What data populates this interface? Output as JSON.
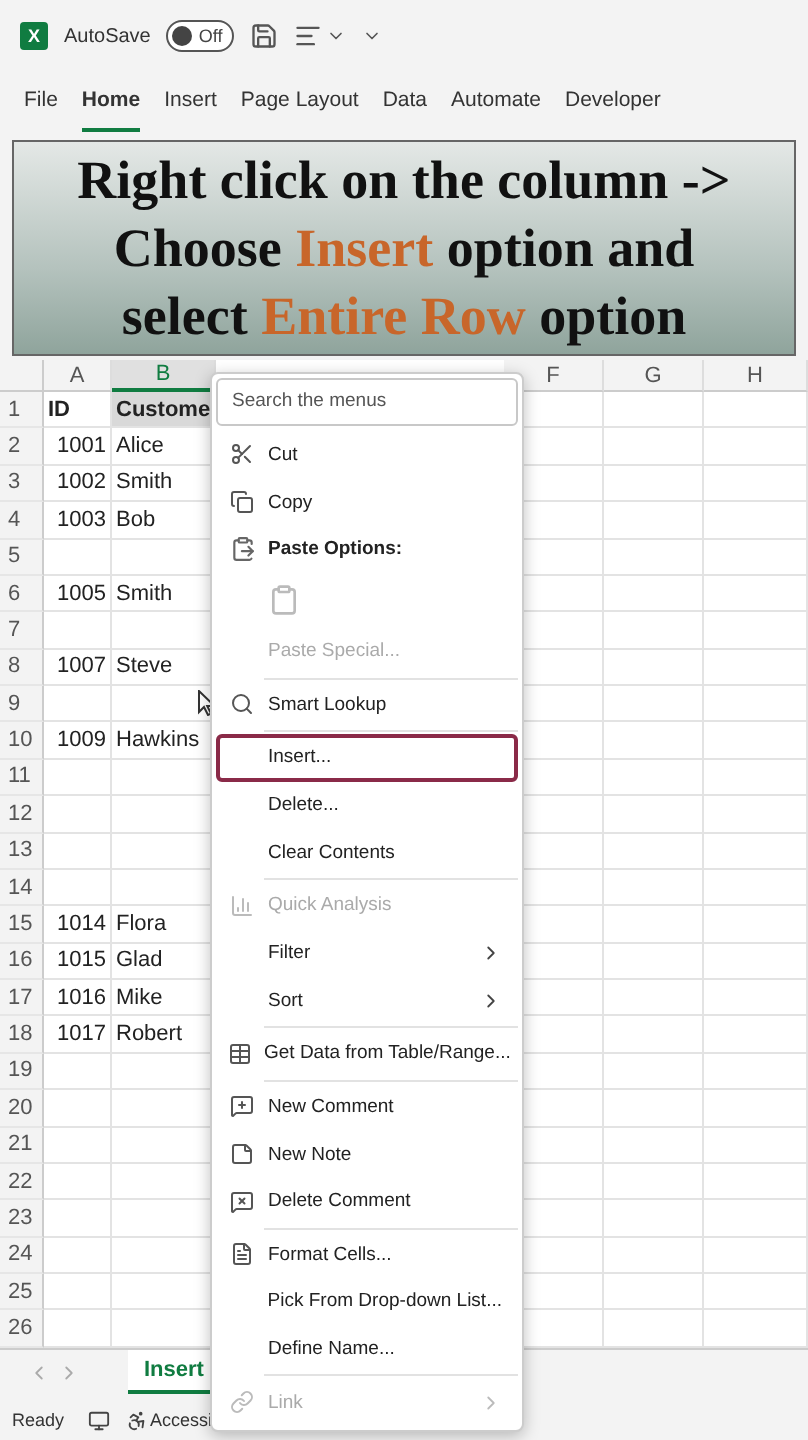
{
  "title_bar": {
    "logo": "X",
    "autosave_label": "AutoSave",
    "autosave": {
      "on": false,
      "label": "Off"
    }
  },
  "ribbon_tabs": [
    {
      "label": "File",
      "selected": false
    },
    {
      "label": "Home",
      "selected": true
    },
    {
      "label": "Insert",
      "selected": false
    },
    {
      "label": "Page Layout",
      "selected": false
    },
    {
      "label": "Data",
      "selected": false
    },
    {
      "label": "Automate",
      "selected": false
    },
    {
      "label": "Developer",
      "selected": false
    }
  ],
  "caption": {
    "lines": [
      [
        {
          "text": "Right click on the column ->",
          "highlight": false
        }
      ],
      [
        {
          "text": "Choose ",
          "highlight": false
        },
        {
          "text": "Insert",
          "highlight": true
        },
        {
          "text": " option and",
          "highlight": false
        }
      ],
      [
        {
          "text": "select ",
          "highlight": false
        },
        {
          "text": "Entire Row",
          "highlight": true
        },
        {
          "text": " option",
          "highlight": false
        }
      ]
    ]
  },
  "sheet": {
    "columns": [
      {
        "label": "A",
        "selected": false
      },
      {
        "label": "B",
        "selected": true
      },
      {
        "label": "F",
        "selected": false
      },
      {
        "label": "G",
        "selected": false
      },
      {
        "label": "H",
        "selected": false
      }
    ],
    "rows": [
      {
        "number": "1",
        "kind": "header",
        "cells": [
          {
            "text": "ID",
            "selected": false
          },
          {
            "text": "Custome",
            "selected": true
          }
        ]
      },
      {
        "number": "2",
        "kind": "data",
        "cells": [
          "1001",
          "Alice"
        ]
      },
      {
        "number": "3",
        "kind": "data",
        "cells": [
          "1002",
          "Smith"
        ]
      },
      {
        "number": "4",
        "kind": "data",
        "cells": [
          "1003",
          "Bob"
        ]
      },
      {
        "number": "5",
        "kind": "data",
        "cells": []
      },
      {
        "number": "6",
        "kind": "data",
        "cells": [
          "1005",
          "Smith"
        ]
      },
      {
        "number": "7",
        "kind": "data",
        "cells": []
      },
      {
        "number": "8",
        "kind": "data",
        "cells": [
          "1007",
          "Steve"
        ]
      },
      {
        "number": "9",
        "kind": "data",
        "cells": []
      },
      {
        "number": "10",
        "kind": "data",
        "cells": [
          "1009",
          "Hawkins"
        ]
      },
      {
        "number": "11",
        "kind": "data",
        "cells": []
      },
      {
        "number": "12",
        "kind": "data",
        "cells": []
      },
      {
        "number": "13",
        "kind": "data",
        "cells": []
      },
      {
        "number": "14",
        "kind": "data",
        "cells": []
      },
      {
        "number": "15",
        "kind": "data",
        "cells": [
          "1014",
          "Flora"
        ]
      },
      {
        "number": "16",
        "kind": "data",
        "cells": [
          "1015",
          "Glad"
        ]
      },
      {
        "number": "17",
        "kind": "data",
        "cells": [
          "1016",
          "Mike"
        ]
      },
      {
        "number": "18",
        "kind": "data",
        "cells": [
          "1017",
          "Robert"
        ]
      },
      {
        "number": "19",
        "kind": "data",
        "cells": []
      },
      {
        "number": "20",
        "kind": "data",
        "cells": []
      },
      {
        "number": "21",
        "kind": "data",
        "cells": []
      },
      {
        "number": "22",
        "kind": "data",
        "cells": []
      },
      {
        "number": "23",
        "kind": "data",
        "cells": []
      },
      {
        "number": "24",
        "kind": "data",
        "cells": []
      },
      {
        "number": "25",
        "kind": "data",
        "cells": []
      },
      {
        "number": "26",
        "kind": "data",
        "cells": []
      }
    ]
  },
  "sheet_tabs": [
    {
      "label": "Insert",
      "selected": true
    }
  ],
  "status_bar": {
    "ready": "Ready",
    "accessibility": "Accessi"
  },
  "context_menu": [
    {
      "kind": "search",
      "placeholder": "Search the menus"
    },
    {
      "kind": "item",
      "label": "Cut",
      "disabled": false,
      "submenu": false,
      "selected": false
    },
    {
      "kind": "item",
      "label": "Copy",
      "disabled": false,
      "submenu": false,
      "selected": false
    },
    {
      "kind": "heading",
      "label": "Paste Options:"
    },
    {
      "kind": "paste-choice",
      "disabled": true
    },
    {
      "kind": "item",
      "label": "Paste Special...",
      "disabled": true,
      "submenu": false,
      "selected": false
    },
    {
      "kind": "separator"
    },
    {
      "kind": "item",
      "label": "Smart Lookup",
      "disabled": false,
      "submenu": false,
      "selected": false
    },
    {
      "kind": "separator"
    },
    {
      "kind": "item",
      "label": "Insert...",
      "disabled": false,
      "submenu": false,
      "selected": true
    },
    {
      "kind": "item",
      "label": "Delete...",
      "disabled": false,
      "submenu": false,
      "selected": false
    },
    {
      "kind": "item",
      "label": "Clear Contents",
      "disabled": false,
      "submenu": false,
      "selected": false
    },
    {
      "kind": "separator"
    },
    {
      "kind": "item",
      "label": "Quick Analysis",
      "disabled": true,
      "submenu": false,
      "selected": false
    },
    {
      "kind": "item",
      "label": "Filter",
      "disabled": false,
      "submenu": true,
      "selected": false
    },
    {
      "kind": "item",
      "label": "Sort",
      "disabled": false,
      "submenu": true,
      "selected": false
    },
    {
      "kind": "separator"
    },
    {
      "kind": "item",
      "label": "Get Data from Table/Range...",
      "disabled": false,
      "submenu": false,
      "selected": false
    },
    {
      "kind": "separator"
    },
    {
      "kind": "item",
      "label": "New Comment",
      "disabled": false,
      "submenu": false,
      "selected": false
    },
    {
      "kind": "item",
      "label": "New Note",
      "disabled": false,
      "submenu": false,
      "selected": false
    },
    {
      "kind": "item",
      "label": "Delete Comment",
      "disabled": false,
      "submenu": false,
      "selected": false
    },
    {
      "kind": "separator"
    },
    {
      "kind": "item",
      "label": "Format Cells...",
      "disabled": false,
      "submenu": false,
      "selected": false
    },
    {
      "kind": "item",
      "label": "Pick From Drop-down List...",
      "disabled": false,
      "submenu": false,
      "selected": false
    },
    {
      "kind": "item",
      "label": "Define Name...",
      "disabled": false,
      "submenu": false,
      "selected": false
    },
    {
      "kind": "separator"
    },
    {
      "kind": "item",
      "label": "Link",
      "disabled": true,
      "submenu": true,
      "selected": false
    }
  ]
}
